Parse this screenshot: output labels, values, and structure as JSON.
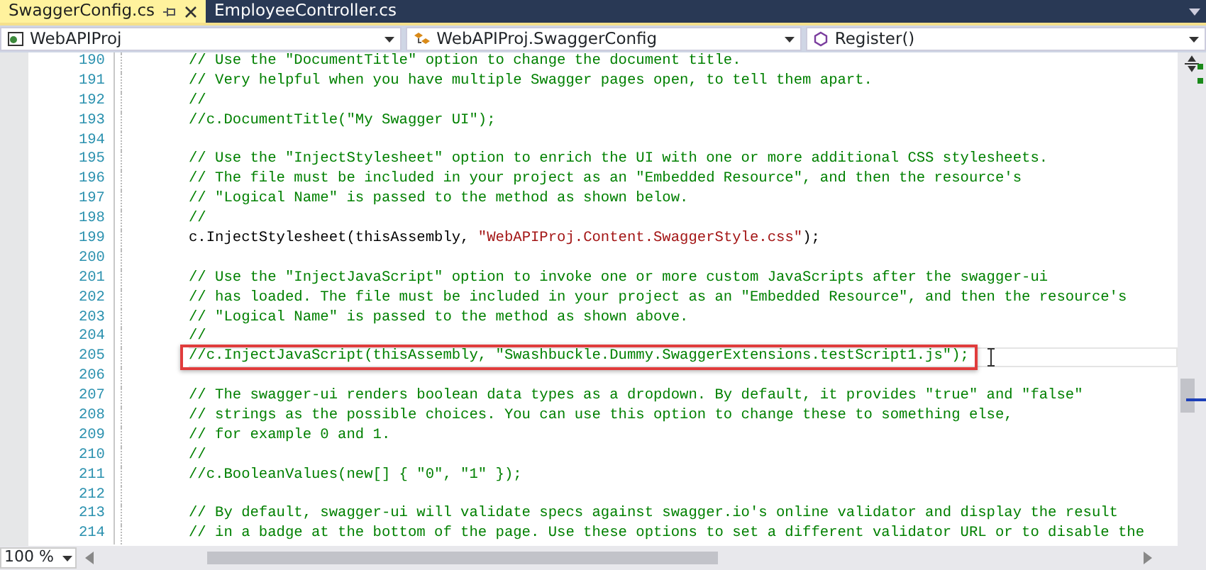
{
  "tabs": [
    {
      "label": "SwaggerConfig.cs",
      "selected": true
    },
    {
      "label": "EmployeeController.cs",
      "selected": false
    }
  ],
  "navigation_bar": {
    "project": "WebAPIProj",
    "type": "WebAPIProj.SwaggerConfig",
    "member": "Register()"
  },
  "editor": {
    "lines": [
      {
        "number": "190",
        "highlighted": false,
        "segments": [
          {
            "kind": "comment",
            "text": "// Use the \"DocumentTitle\" option to change the document title."
          }
        ]
      },
      {
        "number": "191",
        "highlighted": false,
        "segments": [
          {
            "kind": "comment",
            "text": "// Very helpful when you have multiple Swagger pages open, to tell them apart."
          }
        ]
      },
      {
        "number": "192",
        "highlighted": false,
        "segments": [
          {
            "kind": "comment",
            "text": "//"
          }
        ]
      },
      {
        "number": "193",
        "highlighted": false,
        "segments": [
          {
            "kind": "comment",
            "text": "//c.DocumentTitle(\"My Swagger UI\");"
          }
        ]
      },
      {
        "number": "194",
        "highlighted": false
      },
      {
        "number": "195",
        "highlighted": false,
        "segments": [
          {
            "kind": "comment",
            "text": "// Use the \"InjectStylesheet\" option to enrich the UI with one or more additional CSS stylesheets."
          }
        ]
      },
      {
        "number": "196",
        "highlighted": false,
        "segments": [
          {
            "kind": "comment",
            "text": "// The file must be included in your project as an \"Embedded Resource\", and then the resource's"
          }
        ]
      },
      {
        "number": "197",
        "highlighted": false,
        "segments": [
          {
            "kind": "comment",
            "text": "// \"Logical Name\" is passed to the method as shown below."
          }
        ]
      },
      {
        "number": "198",
        "highlighted": false,
        "segments": [
          {
            "kind": "comment",
            "text": "//"
          }
        ]
      },
      {
        "number": "199",
        "highlighted": false,
        "segments": [
          {
            "kind": "plain",
            "text": "c.InjectStylesheet(thisAssembly, "
          },
          {
            "kind": "string",
            "text": "\"WebAPIProj.Content.SwaggerStyle.css\""
          },
          {
            "kind": "plain",
            "text": ");"
          }
        ]
      },
      {
        "number": "200",
        "highlighted": false
      },
      {
        "number": "201",
        "highlighted": false,
        "segments": [
          {
            "kind": "comment",
            "text": "// Use the \"InjectJavaScript\" option to invoke one or more custom JavaScripts after the swagger-ui"
          }
        ]
      },
      {
        "number": "202",
        "highlighted": false,
        "segments": [
          {
            "kind": "comment",
            "text": "// has loaded. The file must be included in your project as an \"Embedded Resource\", and then the resource's"
          }
        ]
      },
      {
        "number": "203",
        "highlighted": false,
        "segments": [
          {
            "kind": "comment",
            "text": "// \"Logical Name\" is passed to the method as shown above."
          }
        ]
      },
      {
        "number": "204",
        "highlighted": false,
        "segments": [
          {
            "kind": "comment",
            "text": "//"
          }
        ]
      },
      {
        "number": "205",
        "highlighted": true,
        "segments": [
          {
            "kind": "comment",
            "text": "//c.InjectJavaScript(thisAssembly, \"Swashbuckle.Dummy.SwaggerExtensions.testScript1.js\");"
          }
        ]
      },
      {
        "number": "206",
        "highlighted": false
      },
      {
        "number": "207",
        "highlighted": false,
        "segments": [
          {
            "kind": "comment",
            "text": "// The swagger-ui renders boolean data types as a dropdown. By default, it provides \"true\" and \"false\""
          }
        ]
      },
      {
        "number": "208",
        "highlighted": false,
        "segments": [
          {
            "kind": "comment",
            "text": "// strings as the possible choices. You can use this option to change these to something else,"
          }
        ]
      },
      {
        "number": "209",
        "highlighted": false,
        "segments": [
          {
            "kind": "comment",
            "text": "// for example 0 and 1."
          }
        ]
      },
      {
        "number": "210",
        "highlighted": false,
        "segments": [
          {
            "kind": "comment",
            "text": "//"
          }
        ]
      },
      {
        "number": "211",
        "highlighted": false,
        "segments": [
          {
            "kind": "comment",
            "text": "//c.BooleanValues(new[] { \"0\", \"1\" });"
          }
        ]
      },
      {
        "number": "212",
        "highlighted": false
      },
      {
        "number": "213",
        "highlighted": false,
        "segments": [
          {
            "kind": "comment",
            "text": "// By default, swagger-ui will validate specs against swagger.io's online validator and display the result"
          }
        ]
      },
      {
        "number": "214",
        "highlighted": false,
        "segments": [
          {
            "kind": "comment",
            "text": "// in a badge at the bottom of the page. Use these options to set a different validator URL or to disable the"
          }
        ]
      }
    ]
  },
  "zoom": "100 %"
}
